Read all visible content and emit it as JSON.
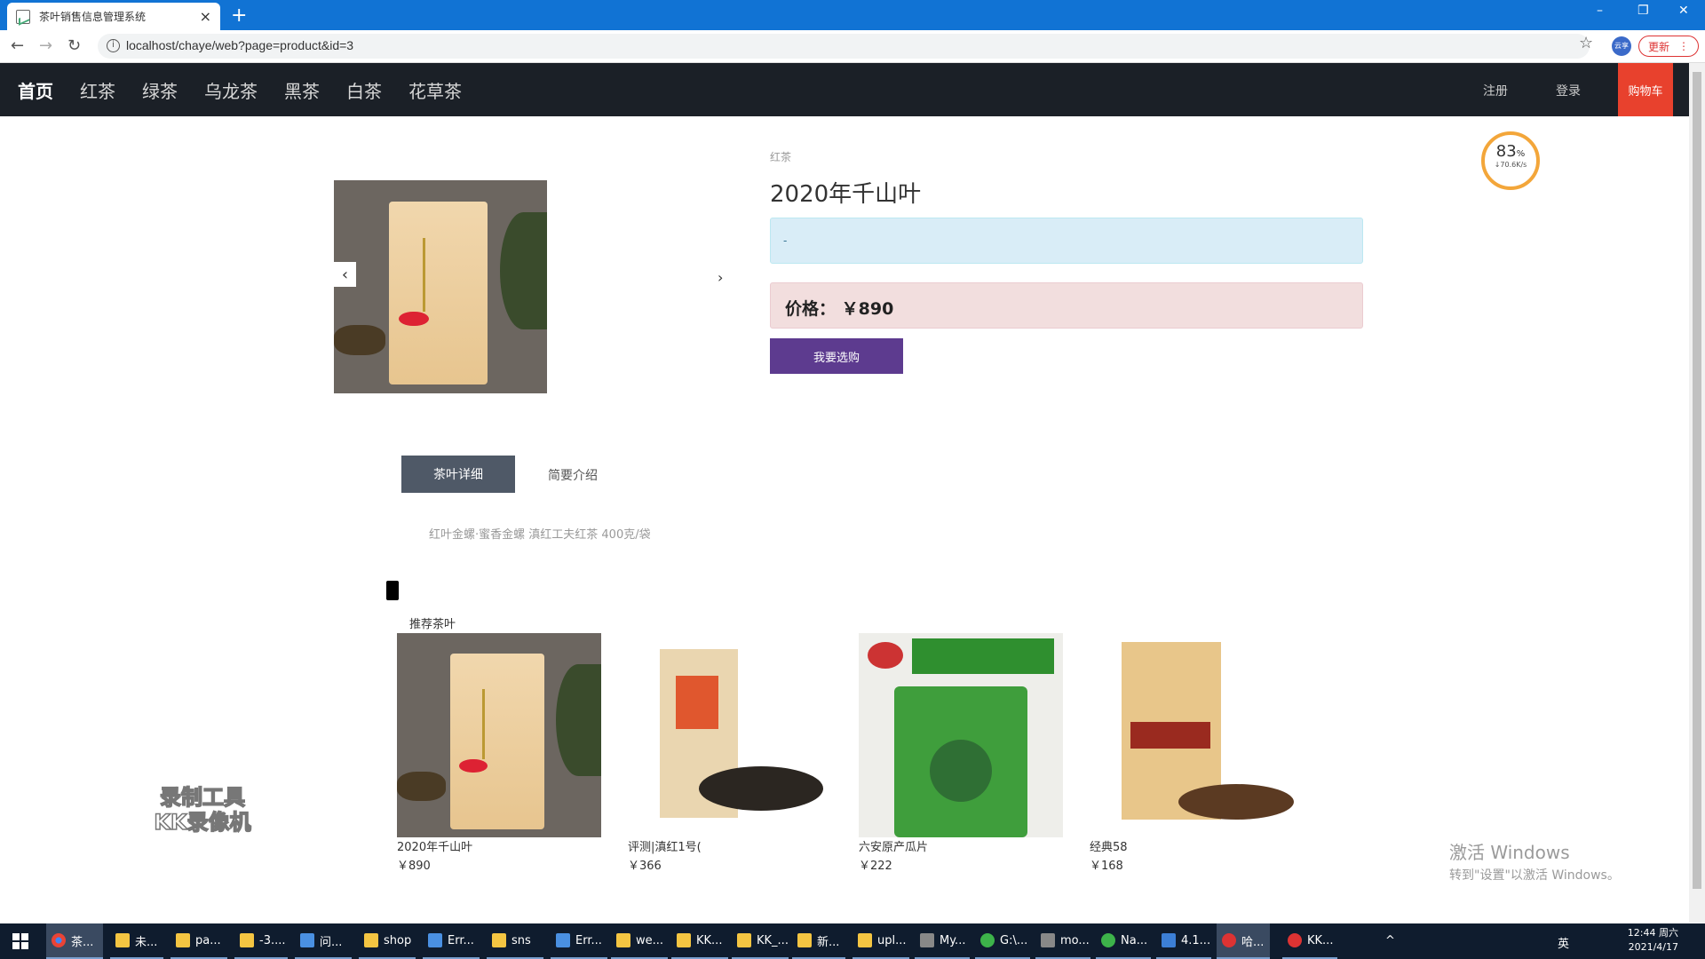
{
  "browser": {
    "tab_title": "茶叶销售信息管理系统",
    "tab_close": "×",
    "new_tab": "+",
    "url": "localhost/chaye/web?page=product&id=3",
    "update_label": "更新",
    "extension_label": "云享",
    "window_controls": [
      "–",
      "❐",
      "✕"
    ]
  },
  "site_nav": {
    "items": [
      "首页",
      "红茶",
      "绿茶",
      "乌龙茶",
      "黑茶",
      "白茶",
      "花草茶"
    ],
    "register": "注册",
    "login": "登录",
    "cart": "购物车"
  },
  "product": {
    "category": "红茶",
    "title": "2020年千山叶",
    "description": "-",
    "price_label": "价格：",
    "price_value": "￥890",
    "buy_label": "我要选购",
    "carousel_prev": "‹",
    "carousel_next": "›"
  },
  "detail_tabs": {
    "tab1": "茶叶详细",
    "tab2": "简要介绍",
    "detail_text": "红叶金螺·蜜香金螺 滇红工夫红茶 400克/袋"
  },
  "recommend": {
    "title": "推荐茶叶",
    "items": [
      {
        "name": "2020年千山叶",
        "price": "￥890"
      },
      {
        "name": "评测|滇红1号(",
        "price": "￥366"
      },
      {
        "name": "六安原产瓜片",
        "price": "￥222"
      },
      {
        "name": "经典58",
        "price": "￥168"
      }
    ]
  },
  "speed_widget": {
    "percent": "83",
    "percent_sign": "%",
    "rate": "↓70.6K/s"
  },
  "watermark": {
    "line1": "录制工具",
    "line2": "KK录像机"
  },
  "activation": {
    "line1": "激活 Windows",
    "line2": "转到\"设置\"以激活 Windows。"
  },
  "taskbar": {
    "items": [
      "茶...",
      "未...",
      "pa...",
      "-3....",
      "问...",
      "shop",
      "Err...",
      "sns",
      "Err...",
      "we...",
      "KK...",
      "KK_...",
      "新...",
      "upl...",
      "My...",
      "G:\\...",
      "mo...",
      "Na...",
      "4.1...",
      "哈...",
      "KK..."
    ],
    "ime": "英",
    "time": "12:44 周六",
    "date": "2021/4/17"
  }
}
